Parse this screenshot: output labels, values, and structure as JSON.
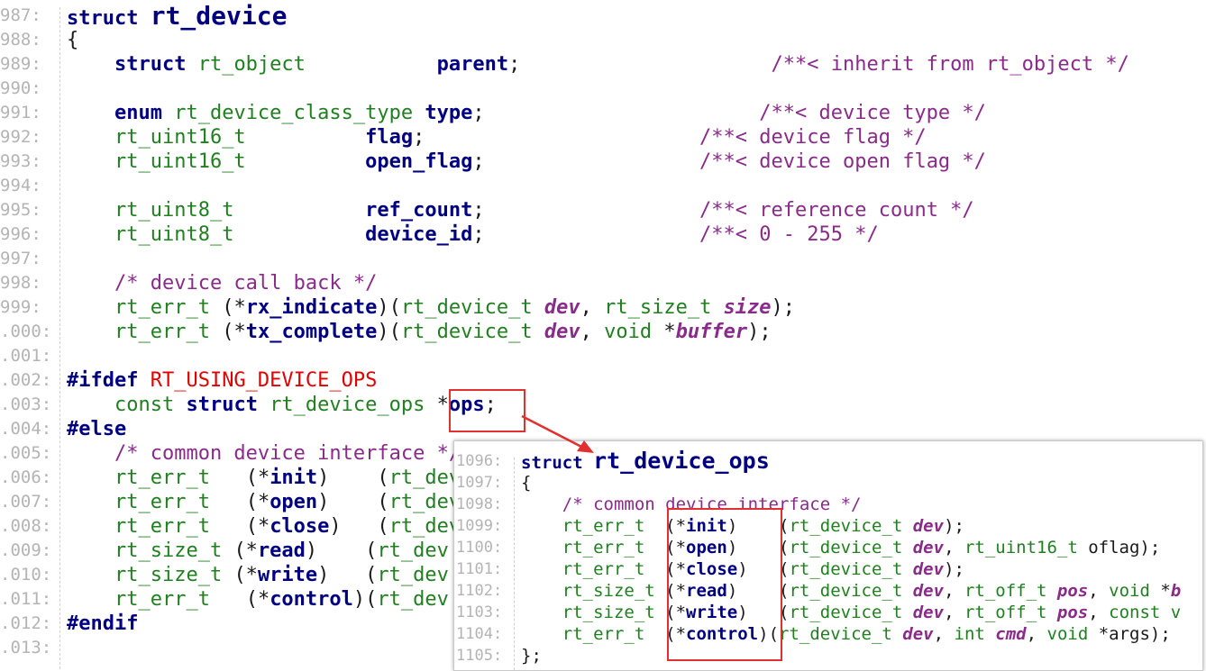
{
  "main": {
    "lines": [
      {
        "n": "987:",
        "parts": [
          [
            "kw",
            "struct "
          ],
          [
            "kw big",
            "rt_device"
          ]
        ]
      },
      {
        "n": "988:",
        "parts": [
          [
            "",
            "{"
          ]
        ]
      },
      {
        "n": "989:",
        "parts": [
          [
            "",
            "    "
          ],
          [
            "kw",
            "struct "
          ],
          [
            "ty",
            "rt_object           "
          ],
          [
            "fn",
            "parent"
          ],
          [
            "",
            ";                     "
          ],
          [
            "cm",
            "/**< inherit from rt_object */"
          ]
        ]
      },
      {
        "n": "990:",
        "parts": []
      },
      {
        "n": "991:",
        "parts": [
          [
            "",
            "    "
          ],
          [
            "kw",
            "enum "
          ],
          [
            "ty",
            "rt_device_class_type "
          ],
          [
            "fn",
            "type"
          ],
          [
            "",
            ";                       "
          ],
          [
            "cm",
            "/**< device type */"
          ]
        ]
      },
      {
        "n": "992:",
        "parts": [
          [
            "",
            "    "
          ],
          [
            "ty",
            "rt_uint16_t          "
          ],
          [
            "fn",
            "flag"
          ],
          [
            "",
            ";                       "
          ],
          [
            "cm",
            "/**< device flag */"
          ]
        ]
      },
      {
        "n": "993:",
        "parts": [
          [
            "",
            "    "
          ],
          [
            "ty",
            "rt_uint16_t          "
          ],
          [
            "fn",
            "open_flag"
          ],
          [
            "",
            ";                  "
          ],
          [
            "cm",
            "/**< device open flag */"
          ]
        ]
      },
      {
        "n": "994:",
        "parts": []
      },
      {
        "n": "995:",
        "parts": [
          [
            "",
            "    "
          ],
          [
            "ty",
            "rt_uint8_t           "
          ],
          [
            "fn",
            "ref_count"
          ],
          [
            "",
            ";                  "
          ],
          [
            "cm",
            "/**< reference count */"
          ]
        ]
      },
      {
        "n": "996:",
        "parts": [
          [
            "",
            "    "
          ],
          [
            "ty",
            "rt_uint8_t           "
          ],
          [
            "fn",
            "device_id"
          ],
          [
            "",
            ";                  "
          ],
          [
            "cm",
            "/**< 0 - 255 */"
          ]
        ]
      },
      {
        "n": "997:",
        "parts": []
      },
      {
        "n": "998:",
        "parts": [
          [
            "",
            "    "
          ],
          [
            "cm",
            "/* device call back */"
          ]
        ]
      },
      {
        "n": "999:",
        "parts": [
          [
            "",
            "    "
          ],
          [
            "ty",
            "rt_err_t"
          ],
          [
            "",
            " (*"
          ],
          [
            "fn",
            "rx_indicate"
          ],
          [
            "",
            ")("
          ],
          [
            "ty",
            "rt_device_t "
          ],
          [
            "par",
            "dev"
          ],
          [
            "",
            ", "
          ],
          [
            "ty",
            "rt_size_t "
          ],
          [
            "par",
            "size"
          ],
          [
            "",
            ");"
          ]
        ]
      },
      {
        "n": ".000:",
        "parts": [
          [
            "",
            "    "
          ],
          [
            "ty",
            "rt_err_t"
          ],
          [
            "",
            " (*"
          ],
          [
            "fn",
            "tx_complete"
          ],
          [
            "",
            ")("
          ],
          [
            "ty",
            "rt_device_t "
          ],
          [
            "par",
            "dev"
          ],
          [
            "",
            ", "
          ],
          [
            "ty",
            "void "
          ],
          [
            "",
            "*"
          ],
          [
            "par",
            "buffer"
          ],
          [
            "",
            ");"
          ]
        ]
      },
      {
        "n": ".001:",
        "parts": []
      },
      {
        "n": ".002:",
        "parts": [
          [
            "pp",
            "#ifdef "
          ],
          [
            "mac",
            "RT_USING_DEVICE_OPS"
          ]
        ]
      },
      {
        "n": ".003:",
        "parts": [
          [
            "",
            "    "
          ],
          [
            "ty",
            "const "
          ],
          [
            "kw",
            "struct "
          ],
          [
            "ty",
            "rt_device_ops "
          ],
          [
            "",
            "*"
          ],
          [
            "fn",
            "ops"
          ],
          [
            "",
            ";"
          ]
        ]
      },
      {
        "n": ".004:",
        "parts": [
          [
            "pp",
            "#else"
          ]
        ]
      },
      {
        "n": ".005:",
        "parts": [
          [
            "",
            "    "
          ],
          [
            "cm",
            "/* common device interface */"
          ]
        ]
      },
      {
        "n": ".006:",
        "parts": [
          [
            "",
            "    "
          ],
          [
            "ty",
            "rt_err_t "
          ],
          [
            "",
            "  (*"
          ],
          [
            "fn",
            "init"
          ],
          [
            "",
            ")    ("
          ],
          [
            "ty",
            "rt_dev"
          ]
        ]
      },
      {
        "n": ".007:",
        "parts": [
          [
            "",
            "    "
          ],
          [
            "ty",
            "rt_err_t "
          ],
          [
            "",
            "  (*"
          ],
          [
            "fn",
            "open"
          ],
          [
            "",
            ")    ("
          ],
          [
            "ty",
            "rt_dev"
          ]
        ]
      },
      {
        "n": ".008:",
        "parts": [
          [
            "",
            "    "
          ],
          [
            "ty",
            "rt_err_t "
          ],
          [
            "",
            "  (*"
          ],
          [
            "fn",
            "close"
          ],
          [
            "",
            ")   ("
          ],
          [
            "ty",
            "rt_dev"
          ]
        ]
      },
      {
        "n": ".009:",
        "parts": [
          [
            "",
            "    "
          ],
          [
            "ty",
            "rt_size_t "
          ],
          [
            "",
            "(*"
          ],
          [
            "fn",
            "read"
          ],
          [
            "",
            ")    ("
          ],
          [
            "ty",
            "rt_dev"
          ]
        ]
      },
      {
        "n": ".010:",
        "parts": [
          [
            "",
            "    "
          ],
          [
            "ty",
            "rt_size_t "
          ],
          [
            "",
            "(*"
          ],
          [
            "fn",
            "write"
          ],
          [
            "",
            ")   ("
          ],
          [
            "ty",
            "rt_dev"
          ]
        ]
      },
      {
        "n": ".011:",
        "parts": [
          [
            "",
            "    "
          ],
          [
            "ty",
            "rt_err_t "
          ],
          [
            "",
            "  (*"
          ],
          [
            "fn",
            "control"
          ],
          [
            "",
            ")("
          ],
          [
            "ty",
            "rt_dev"
          ]
        ]
      },
      {
        "n": ".012:",
        "parts": [
          [
            "pp",
            "#endif"
          ]
        ]
      },
      {
        "n": ".013:",
        "parts": []
      }
    ]
  },
  "popup": {
    "lines": [
      {
        "n": "1096:",
        "parts": [
          [
            "kw",
            "struct "
          ],
          [
            "kw pbig",
            "rt_device_ops"
          ]
        ]
      },
      {
        "n": "1097:",
        "parts": [
          [
            "",
            "{"
          ]
        ]
      },
      {
        "n": "1098:",
        "parts": [
          [
            "",
            "    "
          ],
          [
            "cm",
            "/* common device interface */"
          ]
        ]
      },
      {
        "n": "1099:",
        "parts": [
          [
            "",
            "    "
          ],
          [
            "ty",
            "rt_err_t  "
          ],
          [
            "",
            "(*"
          ],
          [
            "fn",
            "init"
          ],
          [
            "",
            ")    ("
          ],
          [
            "ty",
            "rt_device_t "
          ],
          [
            "par",
            "dev"
          ],
          [
            "",
            ");"
          ]
        ]
      },
      {
        "n": "1100:",
        "parts": [
          [
            "",
            "    "
          ],
          [
            "ty",
            "rt_err_t  "
          ],
          [
            "",
            "(*"
          ],
          [
            "fn",
            "open"
          ],
          [
            "",
            ")    ("
          ],
          [
            "ty",
            "rt_device_t "
          ],
          [
            "par",
            "dev"
          ],
          [
            "",
            ", "
          ],
          [
            "ty",
            "rt_uint16_t "
          ],
          [
            "",
            "oflag);"
          ]
        ]
      },
      {
        "n": "1101:",
        "parts": [
          [
            "",
            "    "
          ],
          [
            "ty",
            "rt_err_t  "
          ],
          [
            "",
            "(*"
          ],
          [
            "fn",
            "close"
          ],
          [
            "",
            ")   ("
          ],
          [
            "ty",
            "rt_device_t "
          ],
          [
            "par",
            "dev"
          ],
          [
            "",
            ");"
          ]
        ]
      },
      {
        "n": "1102:",
        "parts": [
          [
            "",
            "    "
          ],
          [
            "ty",
            "rt_size_t "
          ],
          [
            "",
            "(*"
          ],
          [
            "fn",
            "read"
          ],
          [
            "",
            ")    ("
          ],
          [
            "ty",
            "rt_device_t "
          ],
          [
            "par",
            "dev"
          ],
          [
            "",
            ", "
          ],
          [
            "ty",
            "rt_off_t "
          ],
          [
            "par",
            "pos"
          ],
          [
            "",
            ", "
          ],
          [
            "ty",
            "void "
          ],
          [
            "",
            "*"
          ],
          [
            "par",
            "b"
          ]
        ]
      },
      {
        "n": "1103:",
        "parts": [
          [
            "",
            "    "
          ],
          [
            "ty",
            "rt_size_t "
          ],
          [
            "",
            "(*"
          ],
          [
            "fn",
            "write"
          ],
          [
            "",
            ")   ("
          ],
          [
            "ty",
            "rt_device_t "
          ],
          [
            "par",
            "dev"
          ],
          [
            "",
            ", "
          ],
          [
            "ty",
            "rt_off_t "
          ],
          [
            "par",
            "pos"
          ],
          [
            "",
            ", "
          ],
          [
            "ty",
            "const v"
          ]
        ]
      },
      {
        "n": "1104:",
        "parts": [
          [
            "",
            "    "
          ],
          [
            "ty",
            "rt_err_t  "
          ],
          [
            "",
            "(*"
          ],
          [
            "fn",
            "control"
          ],
          [
            "",
            ")("
          ],
          [
            "ty",
            "rt_device_t "
          ],
          [
            "par",
            "dev"
          ],
          [
            "",
            ", "
          ],
          [
            "ty",
            "int "
          ],
          [
            "par",
            "cmd"
          ],
          [
            "",
            ", "
          ],
          [
            "ty",
            "void "
          ],
          [
            "",
            "*args);"
          ]
        ]
      },
      {
        "n": "1105:",
        "parts": [
          [
            "",
            "};"
          ]
        ]
      }
    ]
  },
  "colors": {
    "keyword": "#000080",
    "type": "#208020",
    "comment": "#8a2a8a",
    "macro": "#e00000",
    "highlight_box": "#e03030"
  }
}
